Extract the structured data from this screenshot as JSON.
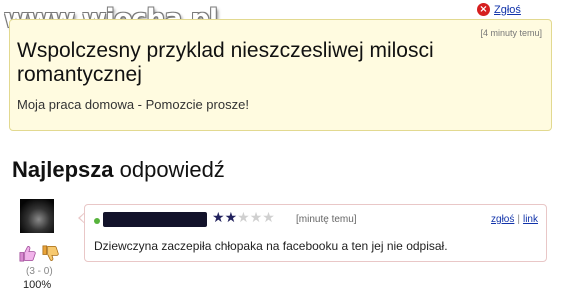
{
  "watermark": "www.wiocha.pl",
  "report": {
    "label": "Zgłoś",
    "icon": "close-circle-icon"
  },
  "question": {
    "time": "[4 minuty temu]",
    "title": "Wspolczesny przyklad nieszczesliwej milosci romantycznej",
    "detail": "Moja praca domowa - Pomozcie prosze!"
  },
  "best_answer": {
    "header_bold": "Najlepsza",
    "header_rest": " odpowiedź",
    "rating": 2,
    "rating_max": 5,
    "time": "[minutę temu]",
    "links": {
      "report": "zgłoś",
      "separator": "|",
      "link": "link"
    },
    "text": "Dziewczyna zaczepiła chłopaka na facebooku a ten jej nie odpisał.",
    "votes": "(3 - 0)",
    "percent": "100%"
  },
  "colors": {
    "question_bg": "#fffbe0",
    "question_border": "#e2d990",
    "answer_border": "#e9c7c7",
    "link": "#1133aa",
    "report_icon": "#d61f1f"
  }
}
